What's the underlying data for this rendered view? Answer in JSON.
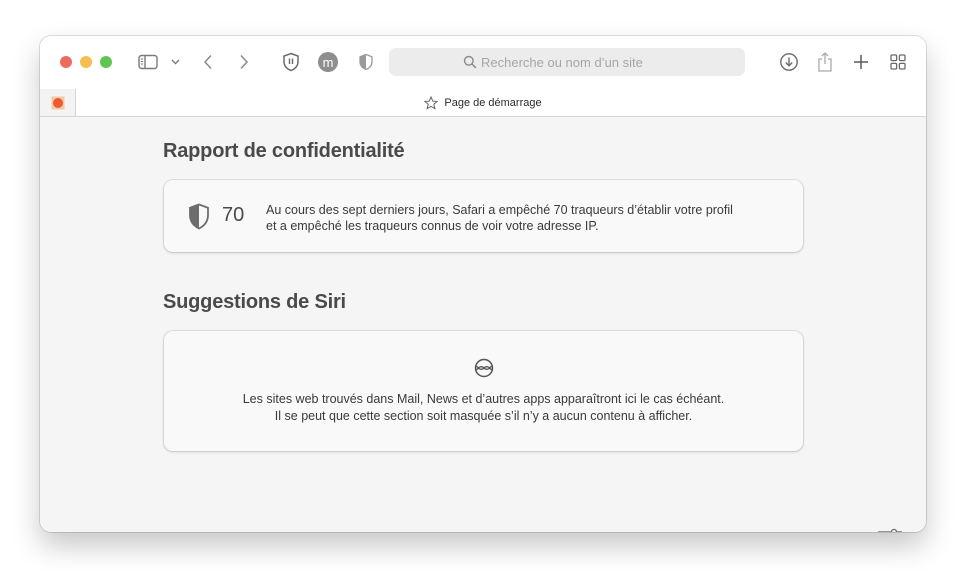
{
  "colors": {
    "close": "#ed6a5e",
    "minimize": "#f5bf4f",
    "zoom": "#61c554"
  },
  "toolbar": {
    "sidebar_icon": "sidebar-icon",
    "back_icon": "chevron-left-icon",
    "forward_icon": "chevron-right-icon",
    "extension_avatar_letter": "m",
    "search_placeholder": "Recherche ou nom d’un site"
  },
  "tab": {
    "title": "Page de démarrage"
  },
  "privacy": {
    "heading": "Rapport de confidentialité",
    "tracker_count": "70",
    "line1": "Au cours des sept derniers jours, Safari a empêché 70 traqueurs d’établir votre profil",
    "line2": "et a empêché les traqueurs connus de voir votre adresse IP."
  },
  "siri": {
    "heading": "Suggestions de Siri",
    "line1": "Les sites web trouvés dans Mail, News et d’autres apps apparaîtront ici le cas échéant.",
    "line2": "Il se peut que cette section soit masquée s’il n’y a aucun contenu à afficher."
  }
}
